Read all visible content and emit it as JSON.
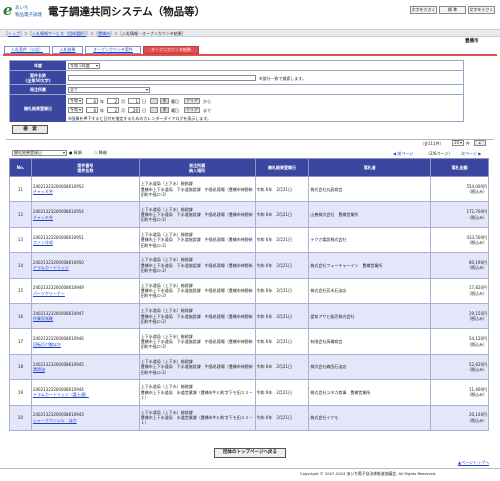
{
  "header": {
    "logo_top": "あいち",
    "logo_sub": "物品電子調達",
    "system_title": "電子調達共同システム（物品等）",
    "font_large": "文字を大きく",
    "font_std": "標 準",
    "font_small": "文字を小さく"
  },
  "breadcrumb": {
    "top": "トップ",
    "service": "入札情報サービス（団体選択）",
    "org": "豊橋市",
    "current": "入札情報・オープンカウンタ結果"
  },
  "org_name": "豊橋市",
  "tabs": [
    "入札案件（公告）",
    "入札結果",
    "オープンカウンタ案件",
    "オープンカウンタ結果"
  ],
  "search": {
    "nendo_label": "年度",
    "nendo_value": "令和 5年度",
    "name_label": "案件名称\n(全角50文字)",
    "name_hint": "※部分一致で検索します。",
    "dept_label": "発注所属",
    "dept_value": "全て",
    "date_label": "開札結果登録日",
    "era": "令和",
    "y1": "6",
    "m1": "2",
    "d1": "1",
    "y2": "6",
    "m2": "2",
    "d2": "29",
    "u_year": "年",
    "u_month": "月",
    "u_day": "日",
    "weekday1": "木",
    "weekday2": "木",
    "youbi": "曜日",
    "clear": "クリア",
    "from": "から",
    "to": "まで",
    "cal_note": "※画像を押下すると日付を指定するためのカレンダーダイアログを表示します。",
    "search_button": "検　索"
  },
  "list_controls": {
    "sort_value": "開札結果登録日",
    "asc": "昇順",
    "desc": "降順",
    "total": "全111件",
    "per_page": "20",
    "per_page_unit": "件",
    "prev": "前ページ",
    "page": "（2/6ページ）",
    "next": "次ページ"
  },
  "table": {
    "headers": {
      "no": "No.",
      "case": "案件番号\n案件名称",
      "dept": "発注所属\n納入場所",
      "date": "開札結果登録日",
      "winner": "落札者",
      "amount": "落札金額"
    },
    "rows": [
      {
        "no": "11",
        "id": "24021323200008610952",
        "name": "チャッキ弁",
        "dept": "上下水道局（上下水）総務課",
        "place": "豊橋市上下水道局　下水道施設課　中島処理場（豊橋市神野新田町中島ロ-2）",
        "date": "令和 6年　2月21日",
        "winner": "株式会社丸辰商会",
        "amount": "554,000円",
        "tax": "（税込み）"
      },
      {
        "no": "12",
        "id": "24021323200008610954",
        "name": "チャッキ弁",
        "dept": "上下水道局（上下水）総務課",
        "place": "豊橋市上下水道局　下水道施設課　中島処理場（豊橋市神野新田町中島ロ-2）",
        "date": "令和 6年　2月21日",
        "winner": "山善株式会社　豊橋営業所",
        "amount": "172,700円",
        "tax": "（税込み）"
      },
      {
        "no": "13",
        "id": "24021323200008610951",
        "name": "ファン冷却",
        "dept": "上下水道局（上下水）総務課",
        "place": "豊橋市上下水道局　下水道施設課　中島処理場（豊橋市神野新田町中島ロ-2）",
        "date": "令和 6年　2月21日",
        "winner": "テクカ電設株式会社",
        "amount": "433,500円",
        "tax": "（税込み）"
      },
      {
        "no": "14",
        "id": "24021323200008610950",
        "name": "ドラムカートリッジ",
        "dept": "上下水道局（上下水）総務課",
        "place": "豊橋市上下水道局　下水道施設課　中島処理場（豊橋市神野新田町中島ロ-2）",
        "date": "令和 6年　2月21日",
        "winner": "株式会社フューチャーイン　豊橋営業所",
        "amount": "80,190円",
        "tax": "（税込み）"
      },
      {
        "no": "15",
        "id": "24021323200008610949",
        "name": "パーツクリーナー",
        "dept": "上下水道局（上下水）総務課",
        "place": "豊橋市上下水道局　下水道施設課　中島処理場（豊橋市神野新田町中島ロ-2）",
        "date": "令和 6年　2月21日",
        "winner": "株式会社芳木石油店",
        "amount": "17,820円",
        "tax": "（税込み）"
      },
      {
        "no": "16",
        "id": "24021323200008610947",
        "name": "作業用長靴",
        "dept": "上下水道局（上下水）総務課",
        "place": "豊橋市上下水道局　下水道施設課　中島処理場（豊橋市神野新田町中島ロ-2）",
        "date": "令和 6年　2月21日",
        "winner": "愛知アサヒ販売株式会社",
        "amount": "29,150円",
        "tax": "（税込み）"
      },
      {
        "no": "17",
        "id": "24021323200008610946",
        "name": "回転灯付腕ほか",
        "dept": "上下水道局（上下水）総務課",
        "place": "豊橋市上下水道局　下水道施設課　中島処理場（豊橋市神野新田町中島ロ-2）",
        "date": "令和 6年　2月21日",
        "winner": "有限会社高橋商会",
        "amount": "54,120円",
        "tax": "（税込み）"
      },
      {
        "no": "18",
        "id": "24021323200008610945",
        "name": "潤滑油",
        "dept": "上下水道局（上下水）総務課",
        "place": "豊橋市上下水道局　下水道施設課　中島処理場（豊橋市神野新田町中島ロ-2）",
        "date": "令和 6年　2月21日",
        "winner": "株式会社森田石油店",
        "amount": "52,620円",
        "tax": "（税込み）"
      },
      {
        "no": "19",
        "id": "24021323200008610944",
        "name": "ドラムカートリッジ（富士通）",
        "dept": "上下水道局（上下水）総務課",
        "place": "豊橋市上下水道局　水道営業課（豊橋市牛川町字下モ田２３－１）",
        "date": "令和 6年　2月21日",
        "winner": "株式会社ユタカ商事　豊橋営業所",
        "amount": "11,400円",
        "tax": "（税込み）"
      },
      {
        "no": "20",
        "id": "24021323200008610943",
        "name": "シャープペンシル　ほか",
        "dept": "上下水道局（上下水）総務課",
        "place": "豊橋市上下水道局　水道営業課（豊橋市牛川町字下モ田２３－１）",
        "date": "令和 6年　2月21日",
        "winner": "株式会社イクモ",
        "amount": "20,140円",
        "tax": "（税込み）"
      }
    ]
  },
  "bottom": {
    "top_button": "団体のトップページへ戻る",
    "page_top": "ページトップへ",
    "copyright": "Copyright © 2007-2024 あいち電子自治体推進協議会. All Rights Reserved."
  }
}
